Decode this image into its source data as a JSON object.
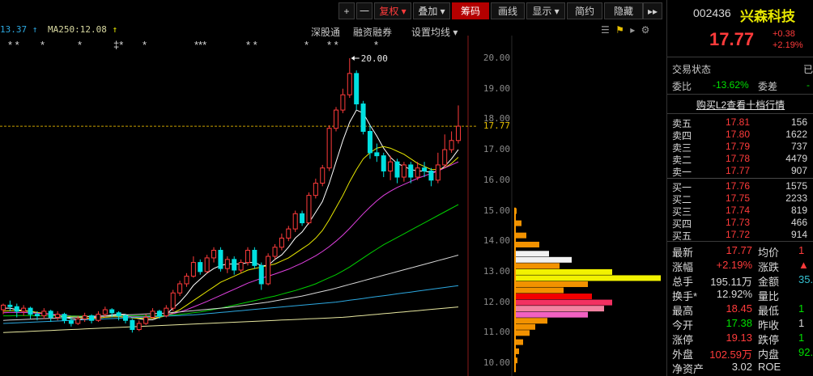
{
  "toolbar": {
    "plus": "+",
    "minus": "一",
    "fuquan": "复权",
    "diejia": "叠加",
    "chouma": "筹码",
    "huaxian": "画线",
    "xianshi": "显示",
    "jianyue": "简约",
    "yincang": "隐藏",
    "play": "▸▸"
  },
  "ma_bar": {
    "ma_left": "13.37",
    "ma250": "MA250:12.08"
  },
  "chart_links": {
    "shengutong": "深股通",
    "rongzirongquan": "融资融券",
    "setting": "设置均线"
  },
  "star_markers": [
    "* *",
    "*",
    "*",
    "‡*",
    "*",
    "***",
    "* *",
    "*",
    "* *",
    "*"
  ],
  "chart_data": {
    "type": "candlestick",
    "high_label": "20.00",
    "last_price_label": "17.77",
    "ylim": [
      9.6,
      20.4
    ],
    "yticks": [
      "20.00",
      "19.00",
      "18.00",
      "17.00",
      "16.00",
      "15.00",
      "14.00",
      "13.00",
      "12.00",
      "11.00",
      "10.00"
    ],
    "candles": [
      [
        11.75,
        11.9,
        11.95,
        11.6
      ],
      [
        11.9,
        11.85,
        12.05,
        11.7
      ],
      [
        11.85,
        11.7,
        11.95,
        11.5
      ],
      [
        11.7,
        11.8,
        11.9,
        11.55
      ],
      [
        11.8,
        11.6,
        11.85,
        11.45
      ],
      [
        11.6,
        11.55,
        11.7,
        11.4
      ],
      [
        11.55,
        11.7,
        11.8,
        11.45
      ],
      [
        11.7,
        11.5,
        11.75,
        11.35
      ],
      [
        11.5,
        11.6,
        11.7,
        11.4
      ],
      [
        11.6,
        11.4,
        11.65,
        11.3
      ],
      [
        11.4,
        11.3,
        11.5,
        11.2
      ],
      [
        11.3,
        11.45,
        11.55,
        11.25
      ],
      [
        11.45,
        11.55,
        11.65,
        11.35
      ],
      [
        11.55,
        11.4,
        11.6,
        11.3
      ],
      [
        11.4,
        11.6,
        11.7,
        11.35
      ],
      [
        11.6,
        11.75,
        11.85,
        11.5
      ],
      [
        11.75,
        11.65,
        11.8,
        11.5
      ],
      [
        11.65,
        11.55,
        11.7,
        11.4
      ],
      [
        11.55,
        11.4,
        11.6,
        11.3
      ],
      [
        11.4,
        11.1,
        11.45,
        11.0
      ],
      [
        11.1,
        11.3,
        11.4,
        11.05
      ],
      [
        11.3,
        11.5,
        11.6,
        11.25
      ],
      [
        11.5,
        11.7,
        11.8,
        11.45
      ],
      [
        11.7,
        11.55,
        11.75,
        11.45
      ],
      [
        11.55,
        11.8,
        11.9,
        11.5
      ],
      [
        11.8,
        12.3,
        12.4,
        11.7
      ],
      [
        12.3,
        12.6,
        12.7,
        12.2
      ],
      [
        12.6,
        12.85,
        12.95,
        12.5
      ],
      [
        12.85,
        13.3,
        13.5,
        12.8
      ],
      [
        13.3,
        13.0,
        13.4,
        12.9
      ],
      [
        13.0,
        13.45,
        13.55,
        12.95
      ],
      [
        13.45,
        13.7,
        13.8,
        13.3
      ],
      [
        13.7,
        13.1,
        13.8,
        13.0
      ],
      [
        13.1,
        13.4,
        13.5,
        12.95
      ],
      [
        13.4,
        13.05,
        13.5,
        12.9
      ],
      [
        13.05,
        13.3,
        13.4,
        12.95
      ],
      [
        13.3,
        13.7,
        13.8,
        13.2
      ],
      [
        13.7,
        13.2,
        13.8,
        13.1
      ],
      [
        13.2,
        12.6,
        13.3,
        12.4
      ],
      [
        12.6,
        13.5,
        13.6,
        12.55
      ],
      [
        13.5,
        13.8,
        13.9,
        13.4
      ],
      [
        13.8,
        14.1,
        14.25,
        13.7
      ],
      [
        14.1,
        14.4,
        14.5,
        14.0
      ],
      [
        14.4,
        14.9,
        15.0,
        14.3
      ],
      [
        14.9,
        14.6,
        15.0,
        14.5
      ],
      [
        14.6,
        15.5,
        15.6,
        14.55
      ],
      [
        15.5,
        15.9,
        16.05,
        15.4
      ],
      [
        15.9,
        16.4,
        16.5,
        15.8
      ],
      [
        16.4,
        17.7,
        17.8,
        16.3
      ],
      [
        17.7,
        18.3,
        18.4,
        17.6
      ],
      [
        18.3,
        18.8,
        19.0,
        18.2
      ],
      [
        18.8,
        19.5,
        20.0,
        18.7
      ],
      [
        19.5,
        18.5,
        19.6,
        18.3
      ],
      [
        18.5,
        17.6,
        18.6,
        17.5
      ],
      [
        17.6,
        16.9,
        17.8,
        16.7
      ],
      [
        16.9,
        16.8,
        17.2,
        16.6
      ],
      [
        16.8,
        16.3,
        16.9,
        16.1
      ],
      [
        16.3,
        16.6,
        16.8,
        16.0
      ],
      [
        16.6,
        16.1,
        16.7,
        15.9
      ],
      [
        16.1,
        16.5,
        16.6,
        15.95
      ],
      [
        16.5,
        16.1,
        16.6,
        15.9
      ],
      [
        16.1,
        16.4,
        16.6,
        16.0
      ],
      [
        16.4,
        16.3,
        16.6,
        16.1
      ],
      [
        16.3,
        16.0,
        16.4,
        15.8
      ],
      [
        16.0,
        16.5,
        16.9,
        15.9
      ],
      [
        16.5,
        17.0,
        17.5,
        16.4
      ],
      [
        17.0,
        17.3,
        17.6,
        16.9
      ],
      [
        17.3,
        17.77,
        18.45,
        17.2
      ]
    ],
    "ma_lines": [
      {
        "color": "#ffffff",
        "values": [
          11.8,
          11.8,
          11.75,
          11.72,
          11.7,
          11.65,
          11.62,
          11.6,
          11.56,
          11.5,
          11.46,
          11.44,
          11.45,
          11.48,
          11.5,
          11.54,
          11.58,
          11.6,
          11.6,
          11.5,
          11.45,
          11.42,
          11.42,
          11.5,
          11.6,
          11.8,
          12.0,
          12.25,
          12.55,
          12.75,
          12.95,
          13.1,
          13.2,
          13.25,
          13.25,
          13.25,
          13.3,
          13.3,
          13.2,
          13.2,
          13.4,
          13.55,
          13.8,
          14.1,
          14.3,
          14.6,
          14.95,
          15.3,
          15.9,
          16.6,
          17.3,
          17.9,
          18.3,
          18.2,
          17.8,
          17.45,
          17.05,
          16.75,
          16.55,
          16.45,
          16.35,
          16.3,
          16.3,
          16.25,
          16.3,
          16.45,
          16.7,
          17.0
        ]
      },
      {
        "color": "#e8e800",
        "values": [
          11.7,
          11.72,
          11.72,
          11.7,
          11.7,
          11.66,
          11.63,
          11.6,
          11.58,
          11.55,
          11.52,
          11.5,
          11.48,
          11.47,
          11.48,
          11.5,
          11.52,
          11.52,
          11.5,
          11.48,
          11.47,
          11.47,
          11.47,
          11.5,
          11.55,
          11.65,
          11.75,
          11.9,
          12.05,
          12.2,
          12.35,
          12.5,
          12.65,
          12.75,
          12.85,
          12.95,
          13.05,
          13.1,
          13.15,
          13.2,
          13.25,
          13.35,
          13.45,
          13.6,
          13.75,
          13.9,
          14.1,
          14.35,
          14.7,
          15.1,
          15.5,
          15.95,
          16.35,
          16.7,
          16.9,
          17.05,
          17.1,
          17.05,
          16.95,
          16.85,
          16.7,
          16.55,
          16.45,
          16.35,
          16.35,
          16.4,
          16.55,
          16.75
        ]
      },
      {
        "color": "#e040e0",
        "values": [
          11.65,
          11.66,
          11.66,
          11.66,
          11.65,
          11.64,
          11.62,
          11.6,
          11.58,
          11.57,
          11.55,
          11.54,
          11.53,
          11.52,
          11.52,
          11.53,
          11.54,
          11.54,
          11.53,
          11.52,
          11.52,
          11.52,
          11.53,
          11.55,
          11.58,
          11.62,
          11.68,
          11.75,
          11.84,
          11.93,
          12.02,
          12.12,
          12.22,
          12.32,
          12.42,
          12.52,
          12.62,
          12.7,
          12.78,
          12.85,
          12.92,
          13.0,
          13.08,
          13.18,
          13.28,
          13.4,
          13.52,
          13.66,
          13.82,
          14.0,
          14.2,
          14.42,
          14.66,
          14.9,
          15.12,
          15.32,
          15.5,
          15.64,
          15.76,
          15.86,
          15.96,
          16.06,
          16.14,
          16.22,
          16.3,
          16.4,
          16.5,
          16.6
        ]
      },
      {
        "color": "#00d000",
        "values": [
          11.55,
          11.55,
          11.56,
          11.56,
          11.56,
          11.55,
          11.55,
          11.55,
          11.55,
          11.54,
          11.54,
          11.54,
          11.54,
          11.54,
          11.54,
          11.54,
          11.55,
          11.55,
          11.55,
          11.55,
          11.55,
          11.55,
          11.56,
          11.56,
          11.57,
          11.58,
          11.6,
          11.62,
          11.65,
          11.68,
          11.72,
          11.76,
          11.8,
          11.85,
          11.9,
          11.95,
          12.0,
          12.05,
          12.1,
          12.15,
          12.2,
          12.26,
          12.32,
          12.38,
          12.45,
          12.52,
          12.6,
          12.7,
          12.8,
          12.9,
          13.02,
          13.15,
          13.3,
          13.45,
          13.6,
          13.74,
          13.88,
          14.0,
          14.12,
          14.24,
          14.36,
          14.48,
          14.6,
          14.72,
          14.84,
          14.96,
          15.08,
          15.2
        ]
      },
      {
        "color": "#d8d8d8",
        "values": [
          11.4,
          11.41,
          11.42,
          11.43,
          11.44,
          11.45,
          11.46,
          11.47,
          11.48,
          11.49,
          11.5,
          11.51,
          11.52,
          11.53,
          11.54,
          11.55,
          11.56,
          11.57,
          11.58,
          11.59,
          11.6,
          11.61,
          11.62,
          11.63,
          11.64,
          11.66,
          11.68,
          11.7,
          11.72,
          11.74,
          11.76,
          11.78,
          11.8,
          11.82,
          11.85,
          11.88,
          11.91,
          11.94,
          11.97,
          12.0,
          12.04,
          12.08,
          12.12,
          12.16,
          12.2,
          12.25,
          12.3,
          12.35,
          12.4,
          12.46,
          12.52,
          12.58,
          12.64,
          12.7,
          12.76,
          12.82,
          12.88,
          12.94,
          13.0,
          13.06,
          13.12,
          13.18,
          13.24,
          13.3,
          13.36,
          13.42,
          13.48,
          13.54
        ]
      },
      {
        "color": "#2ca8e0",
        "values": [
          11.3,
          11.31,
          11.32,
          11.33,
          11.34,
          11.35,
          11.36,
          11.37,
          11.38,
          11.39,
          11.4,
          11.41,
          11.42,
          11.43,
          11.44,
          11.45,
          11.46,
          11.47,
          11.48,
          11.49,
          11.5,
          11.51,
          11.52,
          11.53,
          11.54,
          11.55,
          11.56,
          11.57,
          11.58,
          11.6,
          11.62,
          11.64,
          11.66,
          11.68,
          11.7,
          11.72,
          11.74,
          11.76,
          11.78,
          11.8,
          11.82,
          11.84,
          11.86,
          11.88,
          11.9,
          11.92,
          11.94,
          11.96,
          11.98,
          12.0,
          12.03,
          12.06,
          12.09,
          12.12,
          12.15,
          12.18,
          12.21,
          12.24,
          12.27,
          12.3,
          12.33,
          12.36,
          12.39,
          12.42,
          12.45,
          12.48,
          12.51,
          12.54
        ]
      },
      {
        "color": "#e8e8a0",
        "values": [
          11.0,
          11.01,
          11.02,
          11.03,
          11.04,
          11.05,
          11.06,
          11.07,
          11.08,
          11.09,
          11.1,
          11.11,
          11.12,
          11.13,
          11.14,
          11.15,
          11.16,
          11.17,
          11.18,
          11.19,
          11.2,
          11.21,
          11.22,
          11.23,
          11.24,
          11.25,
          11.26,
          11.27,
          11.28,
          11.29,
          11.3,
          11.31,
          11.32,
          11.33,
          11.34,
          11.35,
          11.36,
          11.37,
          11.38,
          11.39,
          11.4,
          11.41,
          11.42,
          11.43,
          11.44,
          11.45,
          11.46,
          11.47,
          11.48,
          11.49,
          11.5,
          11.52,
          11.54,
          11.56,
          11.58,
          11.6,
          11.62,
          11.64,
          11.66,
          11.68,
          11.7,
          11.72,
          11.74,
          11.76,
          11.78,
          11.8,
          11.82,
          11.84
        ]
      }
    ],
    "chips": [
      {
        "price": 15.0,
        "w": 2,
        "color": "#ff9a00"
      },
      {
        "price": 14.6,
        "w": 8,
        "color": "#ff9a00"
      },
      {
        "price": 14.2,
        "w": 14,
        "color": "#ff9a00"
      },
      {
        "price": 13.9,
        "w": 30,
        "color": "#ff9a00"
      },
      {
        "price": 13.6,
        "w": 42,
        "color": "#ffffff"
      },
      {
        "price": 13.4,
        "w": 70,
        "color": "#ffffff"
      },
      {
        "price": 13.2,
        "w": 55,
        "color": "#ff9a00"
      },
      {
        "price": 13.0,
        "w": 120,
        "color": "#ffff00"
      },
      {
        "price": 12.8,
        "w": 180,
        "color": "#ffff00"
      },
      {
        "price": 12.6,
        "w": 90,
        "color": "#ff9a00"
      },
      {
        "price": 12.4,
        "w": 60,
        "color": "#ff9a00"
      },
      {
        "price": 12.2,
        "w": 95,
        "color": "#ff0000"
      },
      {
        "price": 12.0,
        "w": 120,
        "color": "#ff3366"
      },
      {
        "price": 11.8,
        "w": 110,
        "color": "#ff88aa"
      },
      {
        "price": 11.6,
        "w": 90,
        "color": "#ff66cc"
      },
      {
        "price": 11.4,
        "w": 40,
        "color": "#ff9a00"
      },
      {
        "price": 11.2,
        "w": 25,
        "color": "#ff9a00"
      },
      {
        "price": 11.0,
        "w": 18,
        "color": "#ff9a00"
      },
      {
        "price": 10.7,
        "w": 10,
        "color": "#ff9a00"
      },
      {
        "price": 10.4,
        "w": 5,
        "color": "#ff9a00"
      },
      {
        "price": 10.1,
        "w": 3,
        "color": "#ff9a00"
      }
    ]
  },
  "quote": {
    "code": "002436",
    "name": "兴森科技",
    "price": "17.77",
    "change": "+0.38",
    "pct": "+2.19%",
    "status_label": "交易状态",
    "status_value": "已",
    "weibi_label": "委比",
    "weibi_value": "-13.62%",
    "weicha_label": "委差",
    "weicha_value": "-",
    "l2_link": "购买L2查看十档行情",
    "asks": [
      {
        "label": "卖五",
        "price": "17.81",
        "vol": "156"
      },
      {
        "label": "卖四",
        "price": "17.80",
        "vol": "1622"
      },
      {
        "label": "卖三",
        "price": "17.79",
        "vol": "737"
      },
      {
        "label": "卖二",
        "price": "17.78",
        "vol": "4479"
      },
      {
        "label": "卖一",
        "price": "17.77",
        "vol": "907"
      }
    ],
    "bids": [
      {
        "label": "买一",
        "price": "17.76",
        "vol": "1575"
      },
      {
        "label": "买二",
        "price": "17.75",
        "vol": "2233"
      },
      {
        "label": "买三",
        "price": "17.74",
        "vol": "819"
      },
      {
        "label": "买四",
        "price": "17.73",
        "vol": "466"
      },
      {
        "label": "买五",
        "price": "17.72",
        "vol": "914"
      }
    ],
    "stats": [
      {
        "l1": "最新",
        "v1": "17.77",
        "c1": "red",
        "l2": "均价",
        "v2": "1",
        "c2": "red"
      },
      {
        "l1": "涨幅",
        "v1": "+2.19%",
        "c1": "red",
        "l2": "涨跌",
        "v2": "▲",
        "c2": "red"
      },
      {
        "l1": "总手",
        "v1": "195.11万",
        "c1": "white",
        "l2": "金额",
        "v2": "35.",
        "c2": "cyan"
      },
      {
        "l1": "换手*",
        "v1": "12.92%",
        "c1": "white",
        "l2": "量比",
        "v2": "",
        "c2": "white"
      },
      {
        "l1": "最高",
        "v1": "18.45",
        "c1": "red",
        "l2": "最低",
        "v2": "1",
        "c2": "green"
      },
      {
        "l1": "今开",
        "v1": "17.38",
        "c1": "green",
        "l2": "昨收",
        "v2": "1",
        "c2": "white"
      },
      {
        "l1": "涨停",
        "v1": "19.13",
        "c1": "red",
        "l2": "跌停",
        "v2": "1",
        "c2": "green"
      },
      {
        "l1": "外盘",
        "v1": "102.59万",
        "c1": "red",
        "l2": "内盘",
        "v2": "92.",
        "c2": "green"
      },
      {
        "l1": "净资产",
        "v1": "3.02",
        "c1": "white",
        "l2": "ROE",
        "v2": "",
        "c2": "white"
      }
    ]
  },
  "colors": {
    "up": "#ff3b3b",
    "down": "#00e0e0",
    "accent": "#b40000"
  }
}
